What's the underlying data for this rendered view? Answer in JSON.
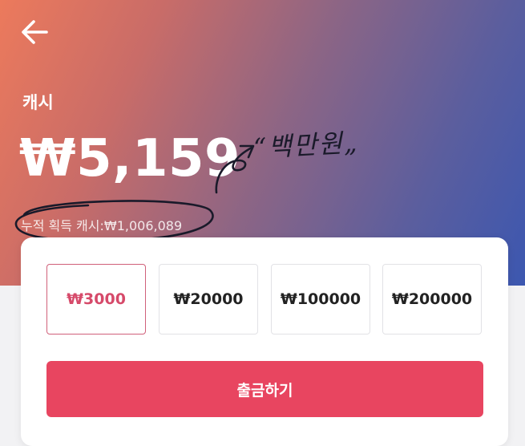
{
  "header": {
    "back_icon": "arrow-left-icon",
    "title": "캐시",
    "balance": "₩5,159",
    "cumulative": "누적 획득 캐시:₩1,006,089"
  },
  "annotation": {
    "handwritten_text": "“백만원„",
    "ink_color": "#1a1a2a"
  },
  "amounts": {
    "options": [
      "₩3000",
      "₩20000",
      "₩100000",
      "₩200000"
    ],
    "selected_index": 0
  },
  "actions": {
    "withdraw_label": "출금하기"
  },
  "colors": {
    "gradient_start": "#ec7a5c",
    "gradient_end": "#3c57b0",
    "accent": "#e84560",
    "selected_text": "#d64a6a"
  }
}
